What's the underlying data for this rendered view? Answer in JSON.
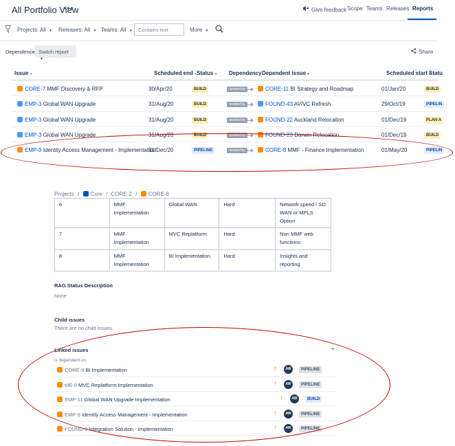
{
  "header": {
    "title": "All Portfolio View",
    "more_glyph": "•••",
    "give_feedback": "Give feedback",
    "nav": [
      "Scope",
      "Teams",
      "Releases",
      "Reports"
    ],
    "active_tab": "Reports"
  },
  "filters": {
    "projects": "Projects: All",
    "releases": "Releases: All",
    "teams": "Teams: All",
    "search_placeholder": "Contains text",
    "more": "More"
  },
  "toolbar": {
    "dependencies": "Dependencies",
    "switch_report": "Switch report",
    "share": "Share"
  },
  "columns": [
    "Issue",
    "Scheduled end",
    "Status",
    "Dependency",
    "Dependent issue",
    "Scheduled start",
    "Statu"
  ],
  "rows": [
    {
      "key": "CORE-7",
      "issue": "MMF Discovery & RFP",
      "icon": "story-orange",
      "end": "30/Apr/20",
      "status": "BUILD",
      "dep": "needed by",
      "dkey": "CORE-11",
      "dissue": "BI Strategy and Roadmap",
      "dicon": "story-orange",
      "start": "01/Jan/20",
      "dstatus": "BUILD"
    },
    {
      "key": "EMP-3",
      "issue": "Global WAN Upgrade",
      "icon": "task-blue",
      "end": "31/Aug/20",
      "status": "BUILD",
      "dep": "needed by",
      "dkey": "FOUND-43",
      "dissue": "AV/VC Refresh",
      "dicon": "task-blue",
      "start": "29/Oct/19",
      "dstatus": "PIPELIN"
    },
    {
      "key": "EMP-3",
      "issue": "Global WAN Upgrade",
      "icon": "task-blue",
      "end": "31/Aug/20",
      "status": "BUILD",
      "dep": "needed by",
      "dkey": "FOUND-22",
      "dissue": "Auckland Relocation",
      "dicon": "story-orange",
      "start": "01/Dec/19",
      "dstatus": "PLAN A"
    },
    {
      "key": "EMP-3",
      "issue": "Global WAN Upgrade",
      "icon": "task-blue",
      "end": "31/Aug/20",
      "status": "BUILD",
      "dep": "needed by",
      "dkey": "FOUND-23",
      "dissue": "Darwin Relocation",
      "dicon": "story-orange",
      "start": "01/Dec/19",
      "dstatus": "BUILD"
    },
    {
      "key": "EMP-9",
      "issue": "Identity Access Management - Implementation",
      "icon": "story-orange",
      "end": "31/Dec/20",
      "status": "PIPELINE",
      "dep": "needed by",
      "dkey": "CORE-8",
      "dissue": "MMF - Finance Implementation",
      "dicon": "story-orange",
      "start": "01/May/20",
      "dstatus": "PIPELIN"
    }
  ],
  "breadcrumb": [
    "Projects",
    "/",
    "Core",
    "/",
    "CORE-2",
    "/",
    "CORE-8"
  ],
  "detail_table": [
    [
      "6",
      "MMF Implementation",
      "Global WAN",
      "Hard",
      "Network speed / SD WAN or MPLS Option"
    ],
    [
      "7",
      "MMF Implementation",
      "MVC Replatform",
      "Hard",
      "Non MMF web functions"
    ],
    [
      "8",
      "MMF Implementation",
      "BI Implementation",
      "Hard",
      "Insights and reporting"
    ]
  ],
  "rag": {
    "title": "RAG Status Description",
    "value": "None"
  },
  "child": {
    "title": "Child issues",
    "value": "There are no child issues."
  },
  "linked": {
    "title": "Linked issues",
    "relation": "is dependent on",
    "add": "+",
    "items": [
      {
        "key": "CORE-9",
        "summary": "BI Implementation",
        "assignee": "AW",
        "status": "PIPELINE"
      },
      {
        "key": "ME-9",
        "summary": "MVC Replatform Implementation",
        "assignee": "AW",
        "status": "PIPELINE"
      },
      {
        "key": "EMP-11",
        "summary": "Global WAN Upgrade Implementation",
        "assignee": "AW",
        "status": "BUILD"
      },
      {
        "key": "EMP-9",
        "summary": "Identity Access Management - Implementation",
        "assignee": "AW",
        "status": "PIPELINE"
      },
      {
        "key": "FOUND-9",
        "summary": "Integration Solution - Implementation",
        "assignee": "AW",
        "status": "PIPELINE"
      }
    ]
  },
  "colors": {
    "link": "#0052cc",
    "annotation": "#c40000",
    "priority": "#ff8b00"
  }
}
